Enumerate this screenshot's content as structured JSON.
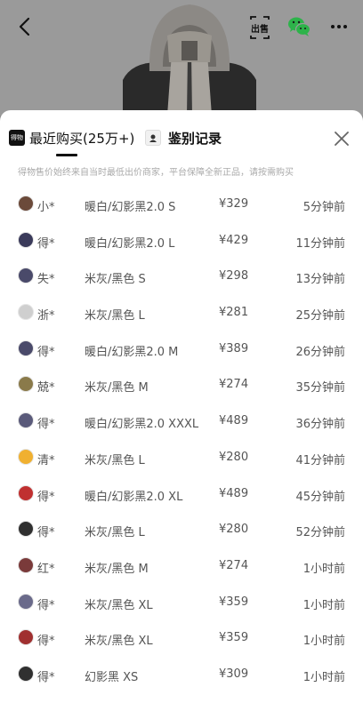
{
  "header": {
    "back_icon": "chevron-left-icon",
    "sell_label": "出售",
    "wechat_icon": "wechat-icon",
    "more_icon": "more-horizontal-icon"
  },
  "sheet": {
    "tabs": [
      {
        "label": "最近购买(25万+)",
        "icon": "dewu-logo-icon",
        "icon_text": "得物",
        "active": true
      },
      {
        "label": "鉴别记录",
        "icon": "certificate-icon",
        "active": false
      }
    ],
    "close_icon": "close-icon",
    "notice": "得物售价始终来自当时最低出价商家，平台保障全新正品，请按需购买"
  },
  "purchases": [
    {
      "user": "小*",
      "spec": "暖白/幻影黑2.0 S",
      "price": "¥329",
      "time": "5分钟前",
      "avatar_color": "#6b4a3a"
    },
    {
      "user": "得*",
      "spec": "暖白/幻影黑2.0 L",
      "price": "¥429",
      "time": "11分钟前",
      "avatar_color": "#3a3a5a"
    },
    {
      "user": "失*",
      "spec": "米灰/黑色 S",
      "price": "¥298",
      "time": "13分钟前",
      "avatar_color": "#4a4a6a"
    },
    {
      "user": "浙*",
      "spec": "米灰/黑色 L",
      "price": "¥281",
      "time": "25分钟前",
      "avatar_color": "#cfcfcf"
    },
    {
      "user": "得*",
      "spec": "暖白/幻影黑2.0 M",
      "price": "¥389",
      "time": "26分钟前",
      "avatar_color": "#4a4a6a"
    },
    {
      "user": "兢*",
      "spec": "米灰/黑色 M",
      "price": "¥274",
      "time": "35分钟前",
      "avatar_color": "#8a7a4a"
    },
    {
      "user": "得*",
      "spec": "暖白/幻影黑2.0 XXXL",
      "price": "¥489",
      "time": "36分钟前",
      "avatar_color": "#5a5a7a"
    },
    {
      "user": "清*",
      "spec": "米灰/黑色 L",
      "price": "¥280",
      "time": "41分钟前",
      "avatar_color": "#f0b030"
    },
    {
      "user": "得*",
      "spec": "暖白/幻影黑2.0 XL",
      "price": "¥489",
      "time": "45分钟前",
      "avatar_color": "#c03030"
    },
    {
      "user": "得*",
      "spec": "米灰/黑色 L",
      "price": "¥280",
      "time": "52分钟前",
      "avatar_color": "#303030"
    },
    {
      "user": "红*",
      "spec": "米灰/黑色 M",
      "price": "¥274",
      "time": "1小时前",
      "avatar_color": "#7a3a3a"
    },
    {
      "user": "得*",
      "spec": "米灰/黑色 XL",
      "price": "¥359",
      "time": "1小时前",
      "avatar_color": "#6a6a8a"
    },
    {
      "user": "得*",
      "spec": "米灰/黑色 XL",
      "price": "¥359",
      "time": "1小时前",
      "avatar_color": "#a03030"
    },
    {
      "user": "得*",
      "spec": "幻影黑 XS",
      "price": "¥309",
      "time": "1小时前",
      "avatar_color": "#303030"
    }
  ]
}
